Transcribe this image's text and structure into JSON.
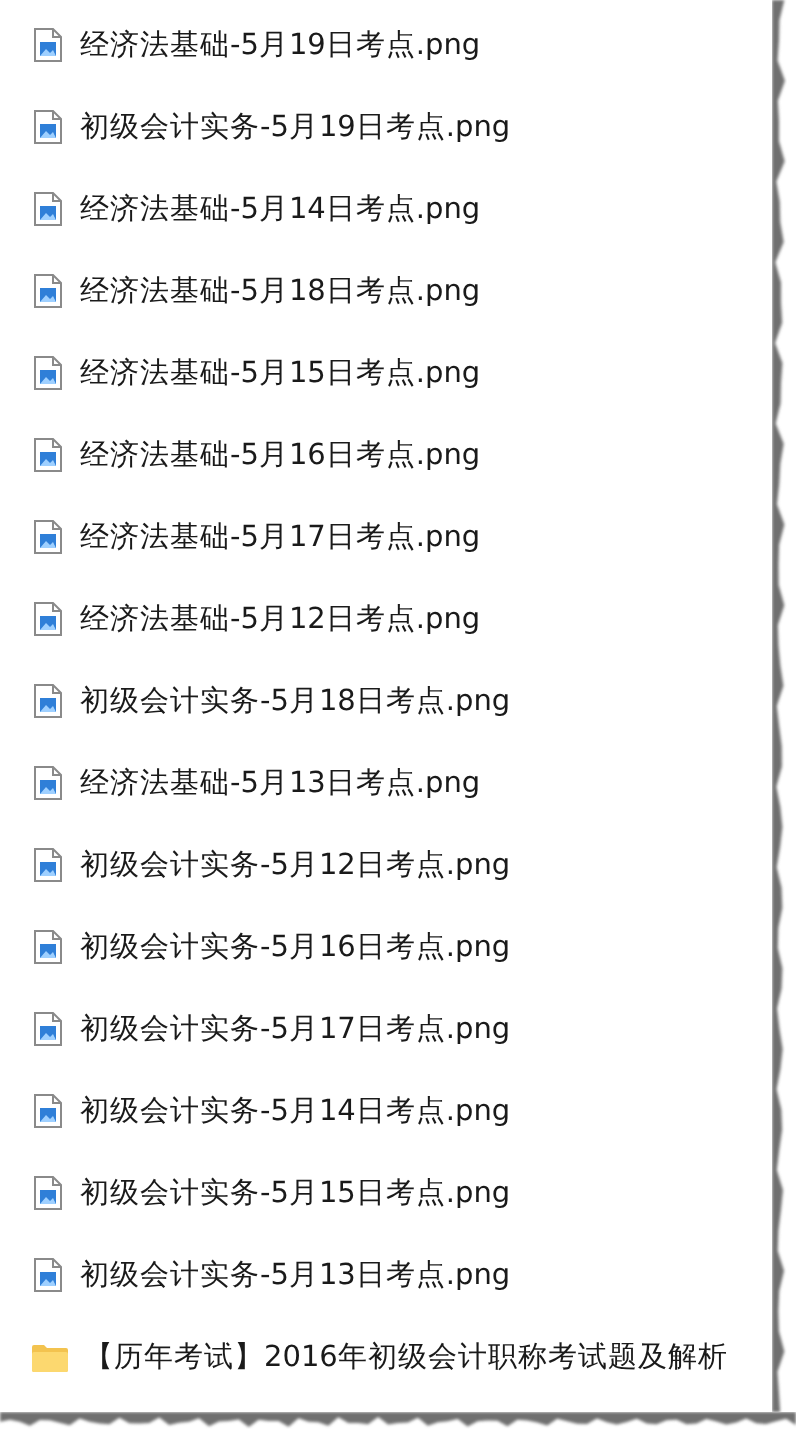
{
  "files": [
    {
      "kind": "image",
      "label": "经济法基础-5月19日考点.png"
    },
    {
      "kind": "image",
      "label": "初级会计实务-5月19日考点.png"
    },
    {
      "kind": "image",
      "label": "经济法基础-5月14日考点.png"
    },
    {
      "kind": "image",
      "label": "经济法基础-5月18日考点.png"
    },
    {
      "kind": "image",
      "label": "经济法基础-5月15日考点.png"
    },
    {
      "kind": "image",
      "label": "经济法基础-5月16日考点.png"
    },
    {
      "kind": "image",
      "label": "经济法基础-5月17日考点.png"
    },
    {
      "kind": "image",
      "label": "经济法基础-5月12日考点.png"
    },
    {
      "kind": "image",
      "label": "初级会计实务-5月18日考点.png"
    },
    {
      "kind": "image",
      "label": "经济法基础-5月13日考点.png"
    },
    {
      "kind": "image",
      "label": "初级会计实务-5月12日考点.png"
    },
    {
      "kind": "image",
      "label": "初级会计实务-5月16日考点.png"
    },
    {
      "kind": "image",
      "label": "初级会计实务-5月17日考点.png"
    },
    {
      "kind": "image",
      "label": "初级会计实务-5月14日考点.png"
    },
    {
      "kind": "image",
      "label": "初级会计实务-5月15日考点.png"
    },
    {
      "kind": "image",
      "label": "初级会计实务-5月13日考点.png"
    },
    {
      "kind": "folder",
      "label": "【历年考试】2016年初级会计职称考试题及解析"
    }
  ]
}
